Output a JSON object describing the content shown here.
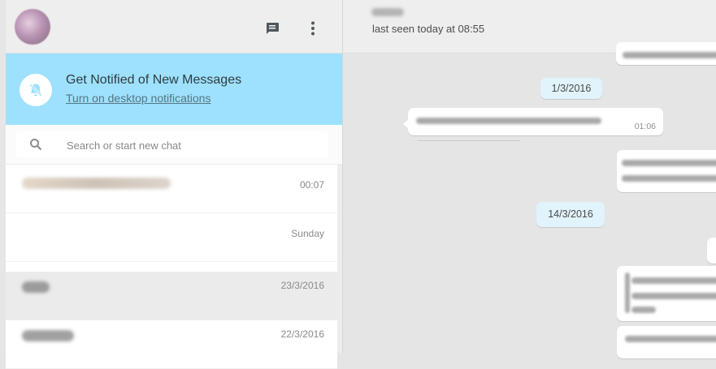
{
  "left_header": {
    "avatar_alt": "",
    "new_chat_icon": "chat-icon",
    "menu_icon": "more-vert-icon"
  },
  "notification_banner": {
    "title": "Get Notified of New Messages",
    "link": "Turn on desktop notifications",
    "icon": "bell-off-icon"
  },
  "search": {
    "placeholder": "Search or start new chat",
    "value": ""
  },
  "chat_list": {
    "items": [
      {
        "time": "00:07",
        "active": false
      },
      {
        "time": "Sunday",
        "active": false
      },
      {
        "time": "23/3/2016",
        "active": true
      },
      {
        "time": "22/3/2016",
        "active": false
      }
    ]
  },
  "conversation": {
    "last_seen": "last seen today at 08:55",
    "date_chips": [
      "1/3/2016",
      "14/3/2016"
    ],
    "messages": [
      {
        "direction": "incoming",
        "time": "01:06"
      }
    ]
  },
  "colors": {
    "banner": "#9de1fe",
    "header": "#eeeeee",
    "chat_background": "#e5e5e5",
    "date_chip": "#e1f3fb",
    "active_row": "#ebebeb"
  }
}
